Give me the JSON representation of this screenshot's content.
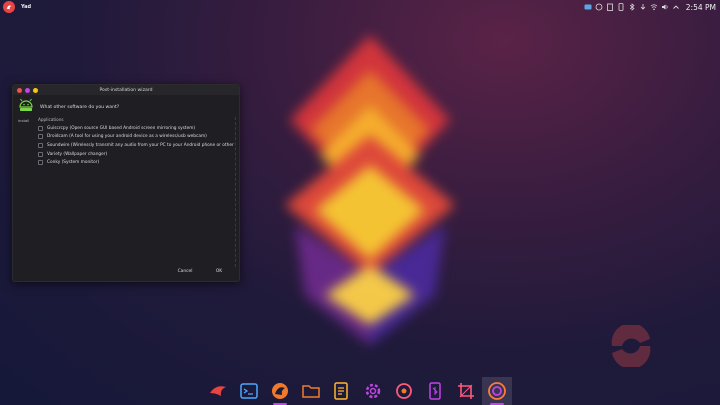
{
  "topbar": {
    "app_title": "Yad",
    "clock": "2:54 PM",
    "tray_icons": [
      "screen-mirror-icon",
      "network-icon",
      "clipboard-icon",
      "device-icon",
      "bluetooth-icon",
      "updates-icon",
      "wifi-icon",
      "volume-icon",
      "chevron-up-icon"
    ]
  },
  "window": {
    "title": "Post-installation wizard",
    "question": "What other software do you want?",
    "side_label": "install",
    "list_header": "Applications",
    "items": [
      {
        "label": "Guiscrcpy (Open source GUI based Android screen mirroring system)",
        "checked": false
      },
      {
        "label": "Droidcam (A tool for using your android device as a wireless/usb webcam)",
        "checked": false
      },
      {
        "label": "Soundwire (Wirelessly transmit any audio from your PC to your Android phone or other",
        "checked": false
      },
      {
        "label": "Variety (Wallpaper changer)",
        "checked": false
      },
      {
        "label": "Conky (System monitor)",
        "checked": false
      }
    ],
    "cancel_label": "Cancel",
    "ok_label": "OK"
  },
  "dock": {
    "items": [
      "bird-app-icon",
      "terminal-icon",
      "browser-icon",
      "file-manager-icon",
      "text-editor-icon",
      "settings-icon",
      "music-player-icon",
      "phone-mirror-icon",
      "crop-tool-icon",
      "screen-recorder-icon"
    ],
    "active_index": 9
  },
  "colors": {
    "accent": "#c044e6",
    "launcher": "#e84444",
    "window_bg": "#1f1f23"
  }
}
